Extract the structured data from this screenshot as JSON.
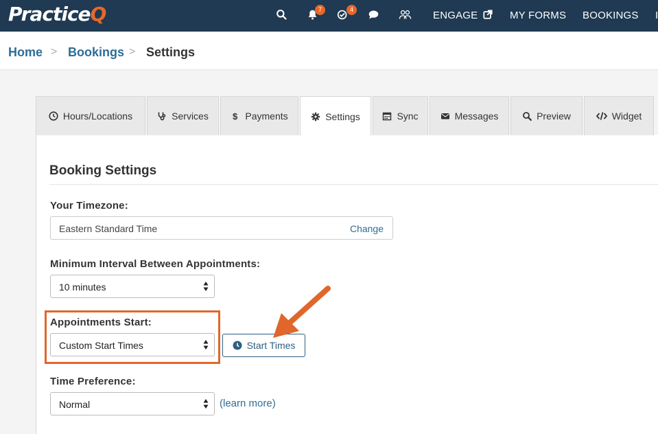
{
  "header": {
    "logo_main": "Practice",
    "logo_accent": "Q",
    "notifications_count": "7",
    "tasks_count": "4",
    "nav": [
      "ENGAGE",
      "MY FORMS",
      "BOOKINGS",
      "I"
    ]
  },
  "breadcrumb": {
    "home": "Home",
    "sep1": ">",
    "bookings": "Bookings",
    "sep2": ">",
    "current": "Settings"
  },
  "tabs": [
    {
      "label": "Hours/Locations",
      "icon": "clock-icon"
    },
    {
      "label": "Services",
      "icon": "stethoscope-icon"
    },
    {
      "label": "Payments",
      "icon": "dollar-icon"
    },
    {
      "label": "Settings",
      "icon": "gear-icon",
      "active": true
    },
    {
      "label": "Sync",
      "icon": "calendar-icon"
    },
    {
      "label": "Messages",
      "icon": "envelope-icon"
    },
    {
      "label": "Preview",
      "icon": "search-icon"
    },
    {
      "label": "Widget",
      "icon": "code-icon"
    }
  ],
  "section": {
    "title": "Booking Settings",
    "timezone_label": "Your Timezone:",
    "timezone_value": "Eastern Standard Time",
    "timezone_change": "Change",
    "min_interval_label": "Minimum Interval Between Appointments:",
    "min_interval_value": "10 minutes",
    "appt_start_label": "Appointments Start:",
    "appt_start_value": "Custom Start Times",
    "start_times_button": "Start Times",
    "time_pref_label": "Time Preference:",
    "time_pref_value": "Normal",
    "learn_more": "(learn more)"
  },
  "colors": {
    "nav_bg": "#1f3a52",
    "accent": "#e8672a",
    "link": "#2d6d96"
  }
}
